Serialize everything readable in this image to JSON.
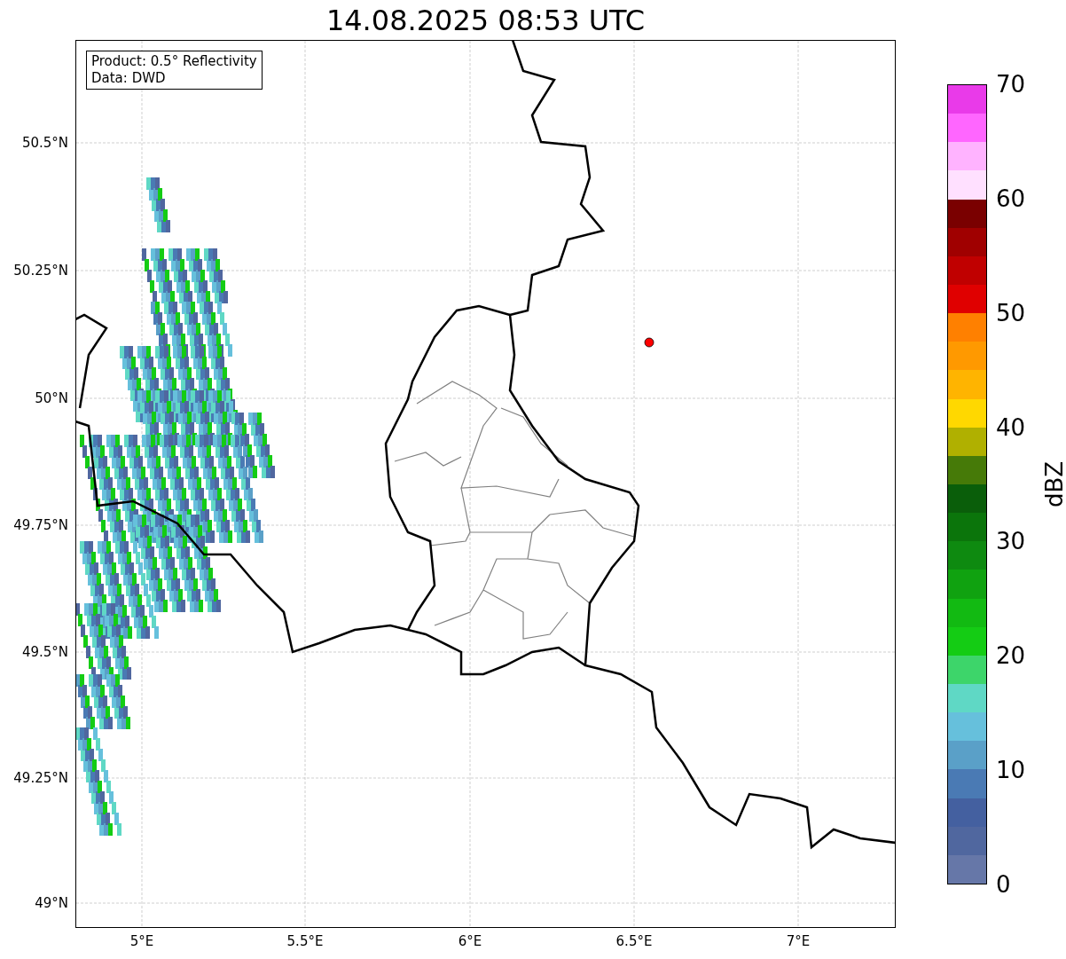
{
  "title": "14.08.2025 08:53 UTC",
  "info_box": {
    "lines": [
      "Product: 0.5° Reflectivity",
      "Data: DWD"
    ]
  },
  "map": {
    "lat_ticks": [
      "50.5°N",
      "50.25°N",
      "50°N",
      "49.75°N",
      "49.5°N",
      "49.25°N",
      "49°N"
    ],
    "lon_ticks": [
      "5°E",
      "5.5°E",
      "6°E",
      "6.5°E",
      "7°E"
    ]
  },
  "colorbar": {
    "label": "dBZ",
    "ticks": [
      "70",
      "60",
      "50",
      "40",
      "30",
      "20",
      "10",
      "0"
    ],
    "segments": [
      {
        "color": "#e93ae9"
      },
      {
        "color": "#ff66ff"
      },
      {
        "color": "#ffb3ff"
      },
      {
        "color": "#ffe0ff"
      },
      {
        "color": "#7a0000"
      },
      {
        "color": "#a00000"
      },
      {
        "color": "#c00000"
      },
      {
        "color": "#e00000"
      },
      {
        "color": "#ff8000"
      },
      {
        "color": "#ff9900"
      },
      {
        "color": "#ffb400"
      },
      {
        "color": "#ffd800"
      },
      {
        "color": "#b0b000"
      },
      {
        "color": "#467a08"
      },
      {
        "color": "#0a5e0a"
      },
      {
        "color": "#0b750b"
      },
      {
        "color": "#0e8a10"
      },
      {
        "color": "#10a210"
      },
      {
        "color": "#12ba12"
      },
      {
        "color": "#14cc14"
      },
      {
        "color": "#3dd56a"
      },
      {
        "color": "#5fd8c5"
      },
      {
        "color": "#66c0dc"
      },
      {
        "color": "#5aa0c8"
      },
      {
        "color": "#4a7ab4"
      },
      {
        "color": "#4460a0"
      },
      {
        "color": "#50679f"
      },
      {
        "color": "#6677a8"
      }
    ]
  }
}
